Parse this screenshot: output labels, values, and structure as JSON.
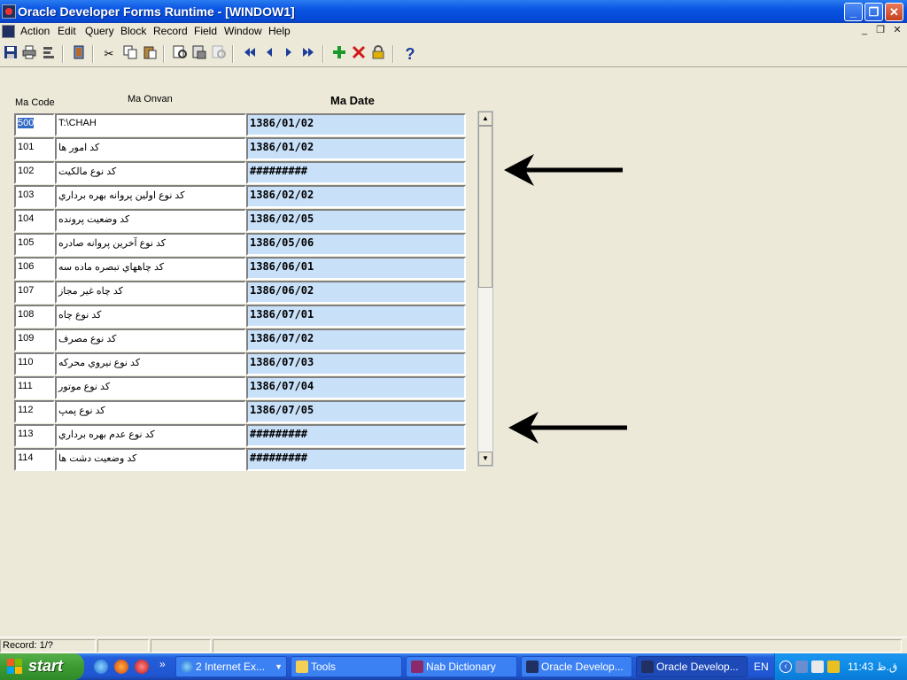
{
  "window": {
    "title": "Oracle Developer Forms Runtime - [WINDOW1]",
    "minimize_label": "_",
    "restore_label": "❐",
    "close_label": "✕"
  },
  "menu": {
    "items": [
      "Action",
      "Edit",
      "Query",
      "Block",
      "Record",
      "Field",
      "Window",
      "Help"
    ],
    "mdi_minimize": "_",
    "mdi_restore": "❐",
    "mdi_close": "✕"
  },
  "toolbar": {
    "help_glyph": "?"
  },
  "form": {
    "headers": {
      "code": "Ma Code",
      "onvan": "Ma Onvan",
      "date": "Ma Date"
    },
    "rows": [
      {
        "code": "500",
        "onvan": "T:\\CHAH",
        "date": "1386/01/02"
      },
      {
        "code": "101",
        "onvan": "كد امور ها",
        "date": "1386/01/02"
      },
      {
        "code": "102",
        "onvan": "كد نوع مالكيت",
        "date": "#########"
      },
      {
        "code": "103",
        "onvan": "كد نوع اولين پروانه بهره برداري",
        "date": "1386/02/02"
      },
      {
        "code": "104",
        "onvan": "كد وضعيت پرونده",
        "date": "1386/02/05"
      },
      {
        "code": "105",
        "onvan": "كد نوع آخرين پروانه صادره",
        "date": "1386/05/06"
      },
      {
        "code": "106",
        "onvan": "كد چاههاي تبصره ماده سه",
        "date": "1386/06/01"
      },
      {
        "code": "107",
        "onvan": "كد چاه غير مجاز",
        "date": "1386/06/02"
      },
      {
        "code": "108",
        "onvan": "كد نوع چاه",
        "date": "1386/07/01"
      },
      {
        "code": "109",
        "onvan": "كد نوع مصرف",
        "date": "1386/07/02"
      },
      {
        "code": "110",
        "onvan": "كد نوع نيروي محركه",
        "date": "1386/07/03"
      },
      {
        "code": "111",
        "onvan": "كد نوع موتور",
        "date": "1386/07/04"
      },
      {
        "code": "112",
        "onvan": "كد نوع پمپ",
        "date": "1386/07/05"
      },
      {
        "code": "113",
        "onvan": "كد نوع عدم بهره برداري",
        "date": "#########"
      },
      {
        "code": "114",
        "onvan": "كد وضعيت دشت ها",
        "date": "#########"
      }
    ]
  },
  "status": {
    "record": "Record: 1/?"
  },
  "taskbar": {
    "start_label": "start",
    "tasks": [
      "2 Internet Ex...",
      "Tools",
      "Nab Dictionary",
      "Oracle Develop...",
      "Oracle Develop..."
    ],
    "language": "EN",
    "clock": "11:43 ق.ظ"
  },
  "colors": {
    "date_field_bg": "#c8e0f8",
    "titlebar": "#0a54e3",
    "selection": "#316ac5"
  }
}
